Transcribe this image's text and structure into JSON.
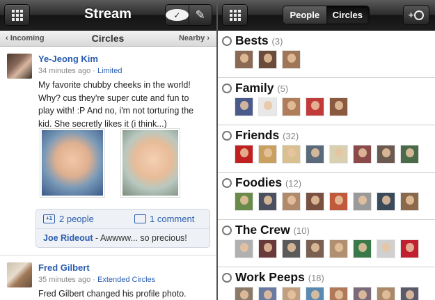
{
  "left": {
    "header": {
      "title": "Stream"
    },
    "subheader": {
      "left": "‹ Incoming",
      "center": "Circles",
      "right": "Nearby ›"
    },
    "post1": {
      "author": "Ye-Jeong Kim",
      "time": "34 minutes ago",
      "sep": " · ",
      "visibility": "Limited",
      "lines": [
        "My favorite chubby cheeks in the world!",
        "Why? cus they're super cute and fun to",
        "play with! :P And no, i'm not torturing the",
        "kid. She secretly likes it (i think...)"
      ],
      "plus_icon": "+1",
      "plus_count": "2 people",
      "comment_count": "1 comment",
      "commenter": "Joe Rideout",
      "comment": " - Awwww... so precious!"
    },
    "post2": {
      "author": "Fred Gilbert",
      "time": "35 minutes ago",
      "sep": " · ",
      "visibility": "Extended Circles",
      "line": "Fred Gilbert changed his profile photo."
    }
  },
  "right": {
    "tabs": {
      "people": "People",
      "circles": "Circles"
    },
    "add_label": "+",
    "circles": [
      {
        "name": "Bests",
        "count": "(3)",
        "faces": [
          "#8a6a55",
          "#6b4b3a",
          "#a07658"
        ]
      },
      {
        "name": "Family",
        "count": "(5)",
        "faces": [
          "#4a5a8a",
          "#e8e8e8",
          "#b07d5a",
          "#c23b3b",
          "#8a5a40"
        ]
      },
      {
        "name": "Friends",
        "count": "(32)",
        "faces": [
          "#c02020",
          "#c9a060",
          "#d8c090",
          "#5a6a7a",
          "#d8d0b0",
          "#8a4a4a",
          "#6a5a50",
          "#4a6a4a"
        ]
      },
      {
        "name": "Foodies",
        "count": "(12)",
        "faces": [
          "#6a8a4a",
          "#4a5060",
          "#b08a6a",
          "#7a5040",
          "#c05a3a",
          "#9a9a9a",
          "#3a4a5a",
          "#8a6a4a"
        ]
      },
      {
        "name": "The Crew",
        "count": "(10)",
        "faces": [
          "#b0b0b0",
          "#6a3a3a",
          "#5a5a5a",
          "#7a6050",
          "#b09070",
          "#3a7a4a",
          "#d0d0d0",
          "#c02030"
        ]
      },
      {
        "name": "Work Peeps",
        "count": "(18)",
        "faces": [
          "#8a7a6a",
          "#6a7aa0",
          "#c0a080",
          "#5a8ab0",
          "#b07a5a",
          "#7a6a7a",
          "#aa8a6a",
          "#5a5a6a"
        ]
      }
    ]
  }
}
